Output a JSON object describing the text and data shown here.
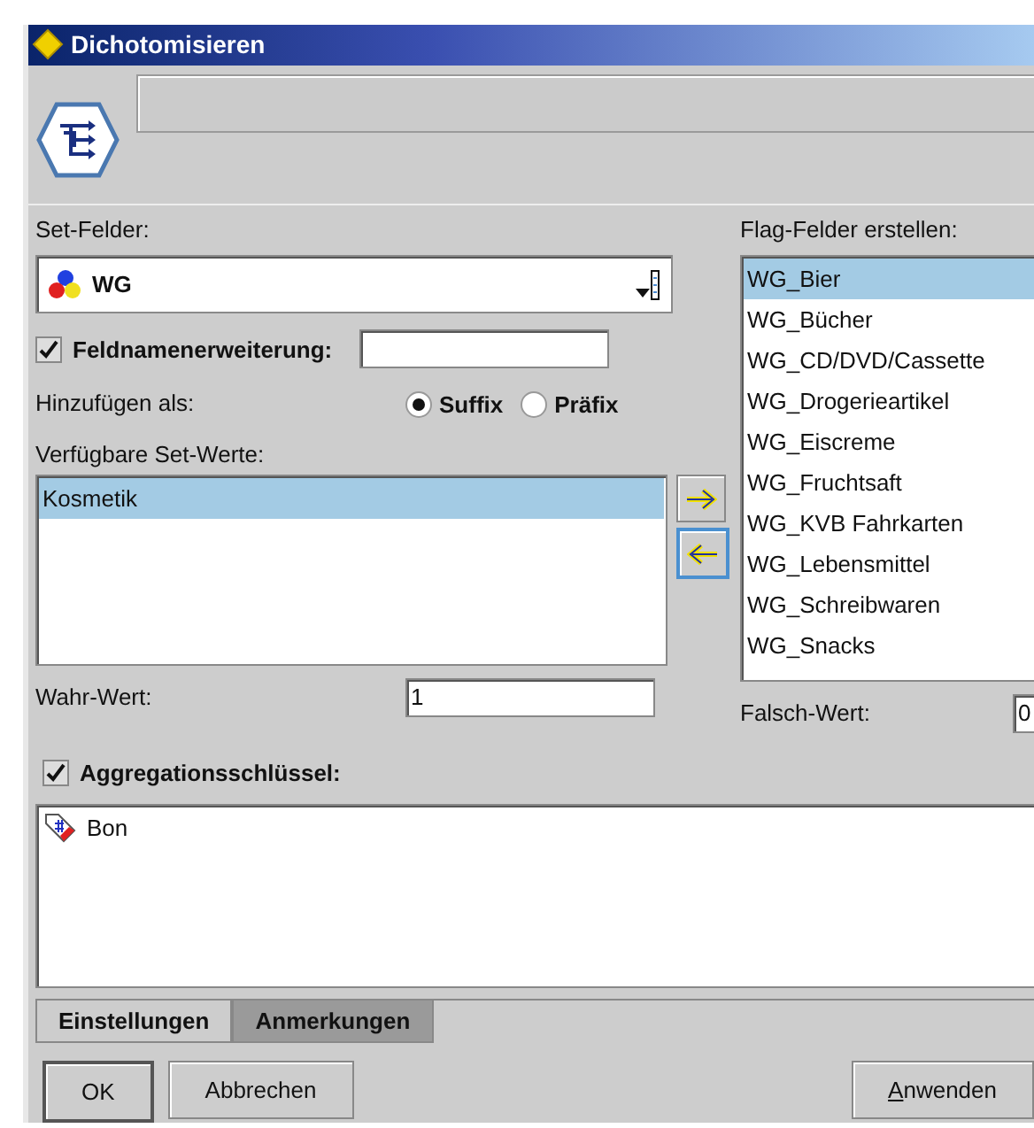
{
  "window": {
    "title": "Dichotomisieren"
  },
  "set_fields": {
    "label": "Set-Felder:",
    "value": "WG"
  },
  "field_name_extension": {
    "label": "Feldnamenerweiterung:",
    "checked": true
  },
  "add_as": {
    "label": "Hinzufügen als:",
    "options": [
      {
        "label": "Suffix",
        "selected": true
      },
      {
        "label": "Präfix",
        "selected": false
      }
    ]
  },
  "available_values": {
    "label": "Verfügbare Set-Werte:",
    "items": [
      {
        "label": "Kosmetik",
        "selected": true
      }
    ]
  },
  "flag_fields": {
    "label": "Flag-Felder erstellen:",
    "items": [
      {
        "label": "WG_Bier",
        "selected": true
      },
      {
        "label": "WG_Bücher",
        "selected": false
      },
      {
        "label": "WG_CD/DVD/Cassette",
        "selected": false
      },
      {
        "label": "WG_Drogerieartikel",
        "selected": false
      },
      {
        "label": "WG_Eiscreme",
        "selected": false
      },
      {
        "label": "WG_Fruchtsaft",
        "selected": false
      },
      {
        "label": "WG_KVB Fahrkarten",
        "selected": false
      },
      {
        "label": "WG_Lebensmittel",
        "selected": false
      },
      {
        "label": "WG_Schreibwaren",
        "selected": false
      },
      {
        "label": "WG_Snacks",
        "selected": false
      }
    ]
  },
  "true_value": {
    "label": "Wahr-Wert:",
    "value": "1"
  },
  "false_value": {
    "label": "Falsch-Wert:",
    "value": "0"
  },
  "aggregation": {
    "label": "Aggregationsschlüssel:",
    "checked": true,
    "items": [
      {
        "label": "Bon"
      }
    ]
  },
  "tabs": [
    {
      "label": "Einstellungen",
      "selected": true
    },
    {
      "label": "Anmerkungen",
      "selected": false
    }
  ],
  "buttons": [
    {
      "label": "OK",
      "default": true
    },
    {
      "label": "Abbrechen",
      "default": false
    },
    {
      "label": "Anwenden",
      "default": false,
      "mnemonic": true
    }
  ]
}
